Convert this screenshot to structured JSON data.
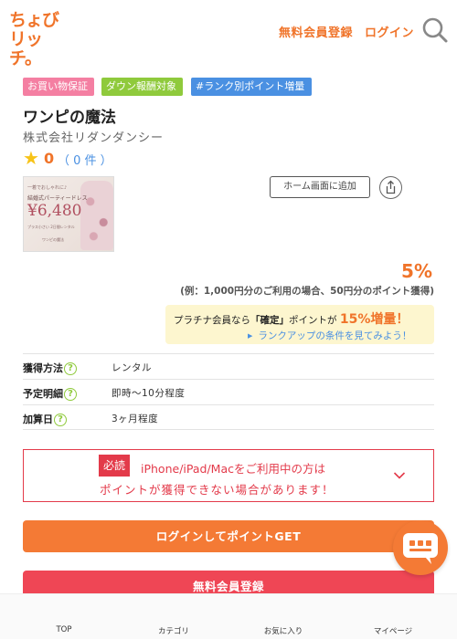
{
  "header": {
    "logo_line1": "ちょび",
    "logo_line2": "リッチ。",
    "signup_label": "無料会員登録",
    "login_label": "ログイン",
    "search_icon": "search-icon"
  },
  "badges": [
    "お買い物保証",
    "ダウン報酬対象",
    "#ランク別ポイント増量"
  ],
  "store": {
    "title": "ワンピの魔法",
    "company": "株式会社リダンダンシー",
    "rating": "0",
    "rating_count": "（ 0 件 ）"
  },
  "thumbnail": {
    "line1": "一着でおしゃれに♪",
    "line2": "結婚式パーティードレス",
    "price": "¥6,480",
    "line3": "プラス小さい 2日間レンタル",
    "line4": "ワンピの魔法"
  },
  "actions": {
    "home_screen_label": "ホーム画面に追加",
    "share_icon": "share-icon"
  },
  "reward": {
    "rate": "5%",
    "example": "(例：1,000円分のご利用の場合、50円分のポイント獲得)"
  },
  "promo": {
    "prefix": "プラチナ会員なら",
    "confirmed": "「確定」",
    "middle": "ポイントが",
    "emphasis": "15%増量！",
    "link": "ランクアップの条件を見てみよう！"
  },
  "info": [
    {
      "label": "獲得方法",
      "value": "レンタル"
    },
    {
      "label": "予定明細",
      "value": "即時～10分程度"
    },
    {
      "label": "加算日",
      "value": "3ヶ月程度"
    }
  ],
  "notice": {
    "tag": "必読",
    "line1": "iPhone/iPad/Macをご利用中の方は",
    "line2": "ポイントが獲得できない場合があります！"
  },
  "buttons": {
    "login_point": "ログインしてポイントGET",
    "signup": "無料会員登録"
  },
  "bottom_nav": [
    "TOP",
    "カテゴリ",
    "お気に入り",
    "マイページ"
  ],
  "colors": {
    "brand_orange": "#f47a35",
    "alert_red": "#e33a4a",
    "link_blue": "#4a90e2",
    "badge_green": "#8fca3c",
    "badge_pink": "#f47fa2"
  }
}
